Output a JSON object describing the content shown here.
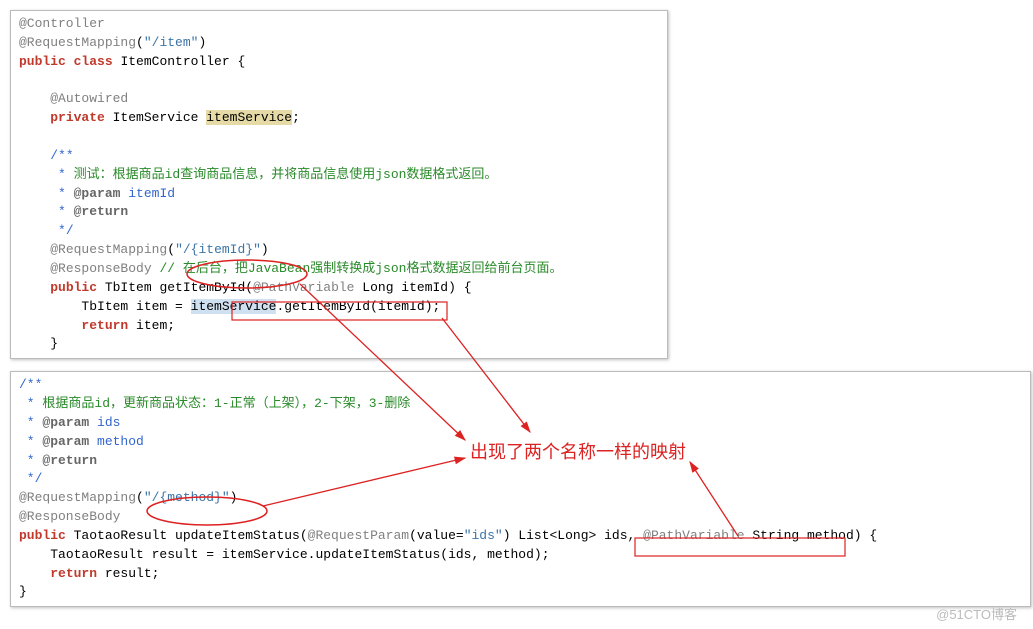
{
  "box1": {
    "l1_anno": "@Controller",
    "l2_anno": "@RequestMapping",
    "l2_str": "\"/item\"",
    "l3a": "public",
    "l3b": "class",
    "l3c": " ItemController {",
    "l4_anno": "@Autowired",
    "l5a": "private",
    "l5b": " ItemService ",
    "l5c": "itemService",
    "l5d": ";",
    "c_open": "/**",
    "c1_star": " * ",
    "c1_txt": "测试：根据商品id查询商品信息，并将商品信息使用json数据格式返回。",
    "c2_star": " * ",
    "c2_tag": "@param",
    "c2_arg": " itemId",
    "c3_star": " * ",
    "c3_tag": "@return",
    "c_close": " */",
    "l6_anno": "@RequestMapping",
    "l6_str": "\"/{itemId}\"",
    "l7_anno": "@ResponseBody",
    "l7_cmt": " // 在后台，把JavaBean强制转换成json格式数据返回给前台页面。",
    "l8a": "public",
    "l8b": " TbItem getItemById(",
    "l8c": "@PathVariable",
    "l8d": " Long itemId",
    "l8e": ") {",
    "l9a": "TbItem item = ",
    "l9b": "itemService",
    "l9c": ".getItemById(itemId);",
    "l10a": "return",
    "l10b": " item;",
    "l11": "}"
  },
  "box2": {
    "c_open": "/**",
    "c1_star": " * ",
    "c1_txt": "根据商品id，更新商品状态：1-正常（上架），2-下架，3-删除",
    "c2_star": " * ",
    "c2_tag": "@param",
    "c2_arg": " ids",
    "c3_star": " * ",
    "c3_tag": "@param",
    "c3_arg": " method",
    "c4_star": " * ",
    "c4_tag": "@return",
    "c_close": " */",
    "l1_anno": "@RequestMapping",
    "l1_str": "\"/{method}\"",
    "l2_anno": "@ResponseBody",
    "l3a": "public",
    "l3b": " TaotaoResult updateItemStatus(",
    "l3c": "@RequestParam",
    "l3d": "(value=",
    "l3e": "\"ids\"",
    "l3f": ") List<Long> ids, ",
    "l3g": "@PathVariable",
    "l3h": " String method",
    "l3i": ") {",
    "l4": "TaotaoResult result = itemService.updateItemStatus(ids, method);",
    "l5a": "return",
    "l5b": " result;",
    "l6": "}"
  },
  "annotation": {
    "text": "出现了两个名称一样的映射"
  },
  "watermark": "@51CTO博客"
}
